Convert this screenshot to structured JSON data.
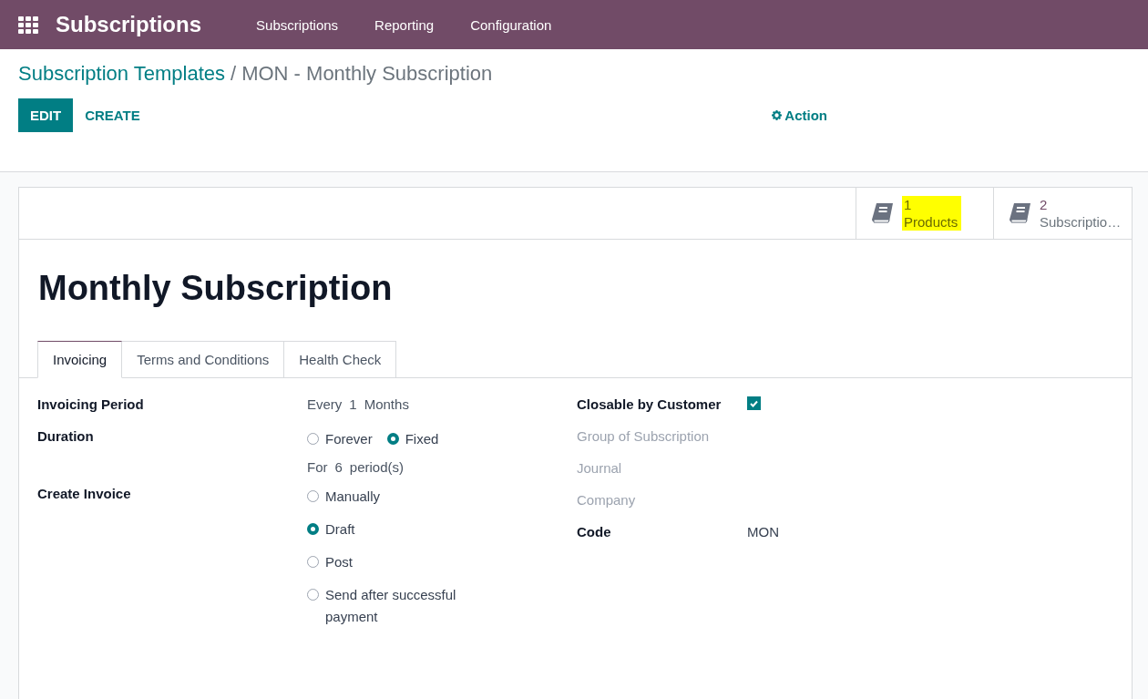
{
  "navbar": {
    "app_name": "Subscriptions",
    "menu": [
      "Subscriptions",
      "Reporting",
      "Configuration"
    ]
  },
  "breadcrumb": {
    "parent": "Subscription Templates",
    "separator": "/",
    "current": "MON - Monthly Subscription"
  },
  "buttons": [
    {
      "label": "EDIT",
      "kind": "primary"
    },
    {
      "label": "CREATE",
      "kind": "secondary"
    }
  ],
  "action": {
    "label": "Action"
  },
  "stat_buttons": [
    {
      "count": "1",
      "label": "Products",
      "highlighted": true
    },
    {
      "count": "2",
      "label": "Subscriptio…",
      "highlighted": false
    }
  ],
  "title": "Monthly Subscription",
  "tabs": [
    {
      "label": "Invoicing",
      "selected": true
    },
    {
      "label": "Terms and Conditions",
      "selected": false
    },
    {
      "label": "Health Check",
      "selected": false
    }
  ],
  "left_fields": [
    {
      "label": "Invoicing Period",
      "kind": "parts",
      "parts": [
        "Every",
        "1",
        "Months"
      ]
    },
    {
      "label": "Duration",
      "kind": "radio_inline",
      "options": [
        {
          "label": "Forever",
          "selected": false
        },
        {
          "label": "Fixed",
          "selected": true
        }
      ],
      "sub_parts": [
        "For",
        "6",
        "period(s)"
      ]
    },
    {
      "label": "Create Invoice",
      "kind": "radio_list",
      "options": [
        {
          "label": "Manually",
          "selected": false
        },
        {
          "label": "Draft",
          "selected": true
        },
        {
          "label": "Post",
          "selected": false
        },
        {
          "label": "Send after successful payment",
          "selected": false
        }
      ]
    }
  ],
  "right_fields": [
    {
      "label": "Closable by Customer",
      "kind": "checkbox",
      "checked": true
    },
    {
      "label": "Group of Subscription",
      "kind": "empty"
    },
    {
      "label": "Journal",
      "kind": "empty"
    },
    {
      "label": "Company",
      "kind": "empty"
    },
    {
      "label": "Code",
      "kind": "text",
      "value": "MON"
    }
  ]
}
